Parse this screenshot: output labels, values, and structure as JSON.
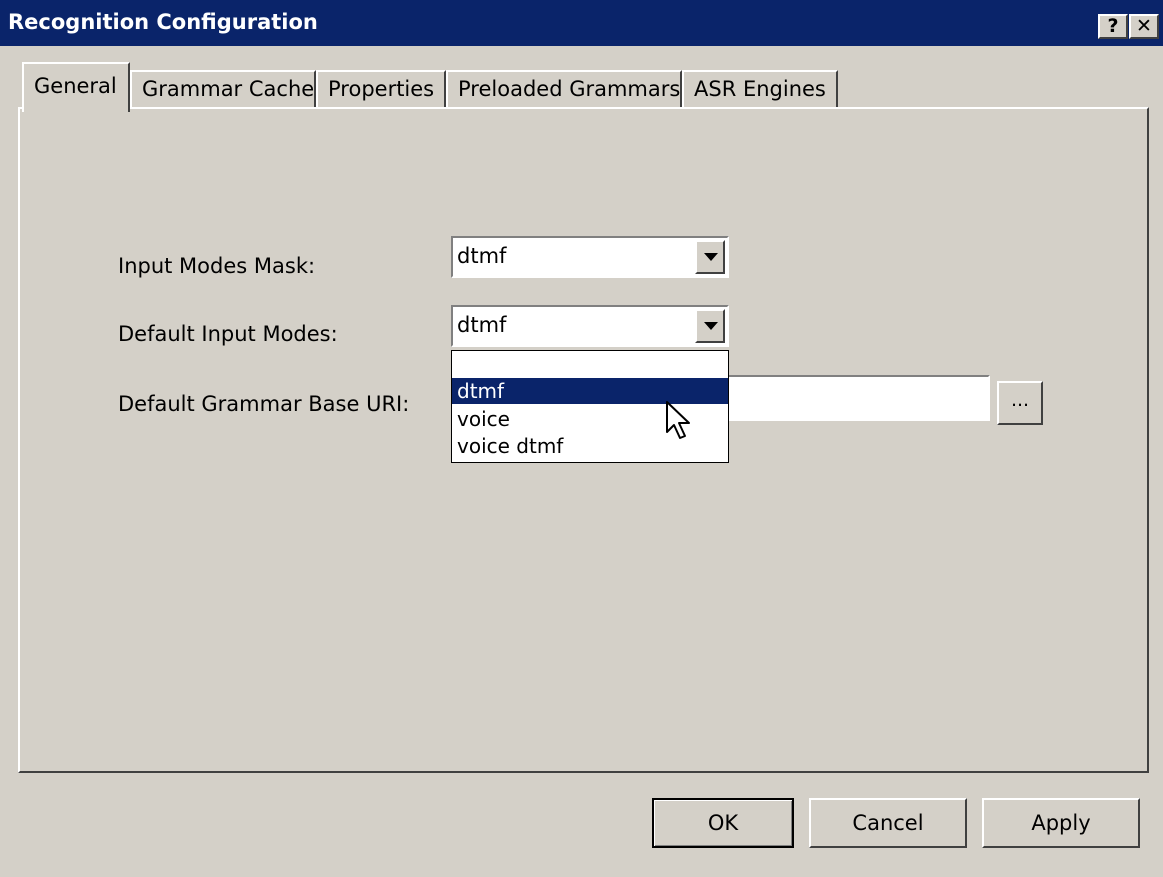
{
  "window": {
    "title": "Recognition Configuration",
    "help_label": "?",
    "close_label": "✕"
  },
  "tabs": [
    {
      "label": "General",
      "active": true
    },
    {
      "label": "Grammar Cache"
    },
    {
      "label": "Properties"
    },
    {
      "label": "Preloaded Grammars"
    },
    {
      "label": "ASR Engines"
    }
  ],
  "form": {
    "input_modes_mask": {
      "label": "Input Modes Mask:",
      "value": "dtmf"
    },
    "default_input_modes": {
      "label": "Default Input Modes:",
      "value": "dtmf"
    },
    "default_grammar_base_uri": {
      "label": "Default Grammar Base URI:",
      "value": "",
      "browse_label": "..."
    }
  },
  "dropdown": {
    "options": [
      "",
      "dtmf",
      "voice",
      "voice dtmf"
    ],
    "selected_index": 1
  },
  "buttons": {
    "ok": "OK",
    "cancel": "Cancel",
    "apply": "Apply"
  },
  "colors": {
    "titlebar": "#0a246a",
    "face": "#d4d0c8",
    "selection": "#0a246a"
  }
}
